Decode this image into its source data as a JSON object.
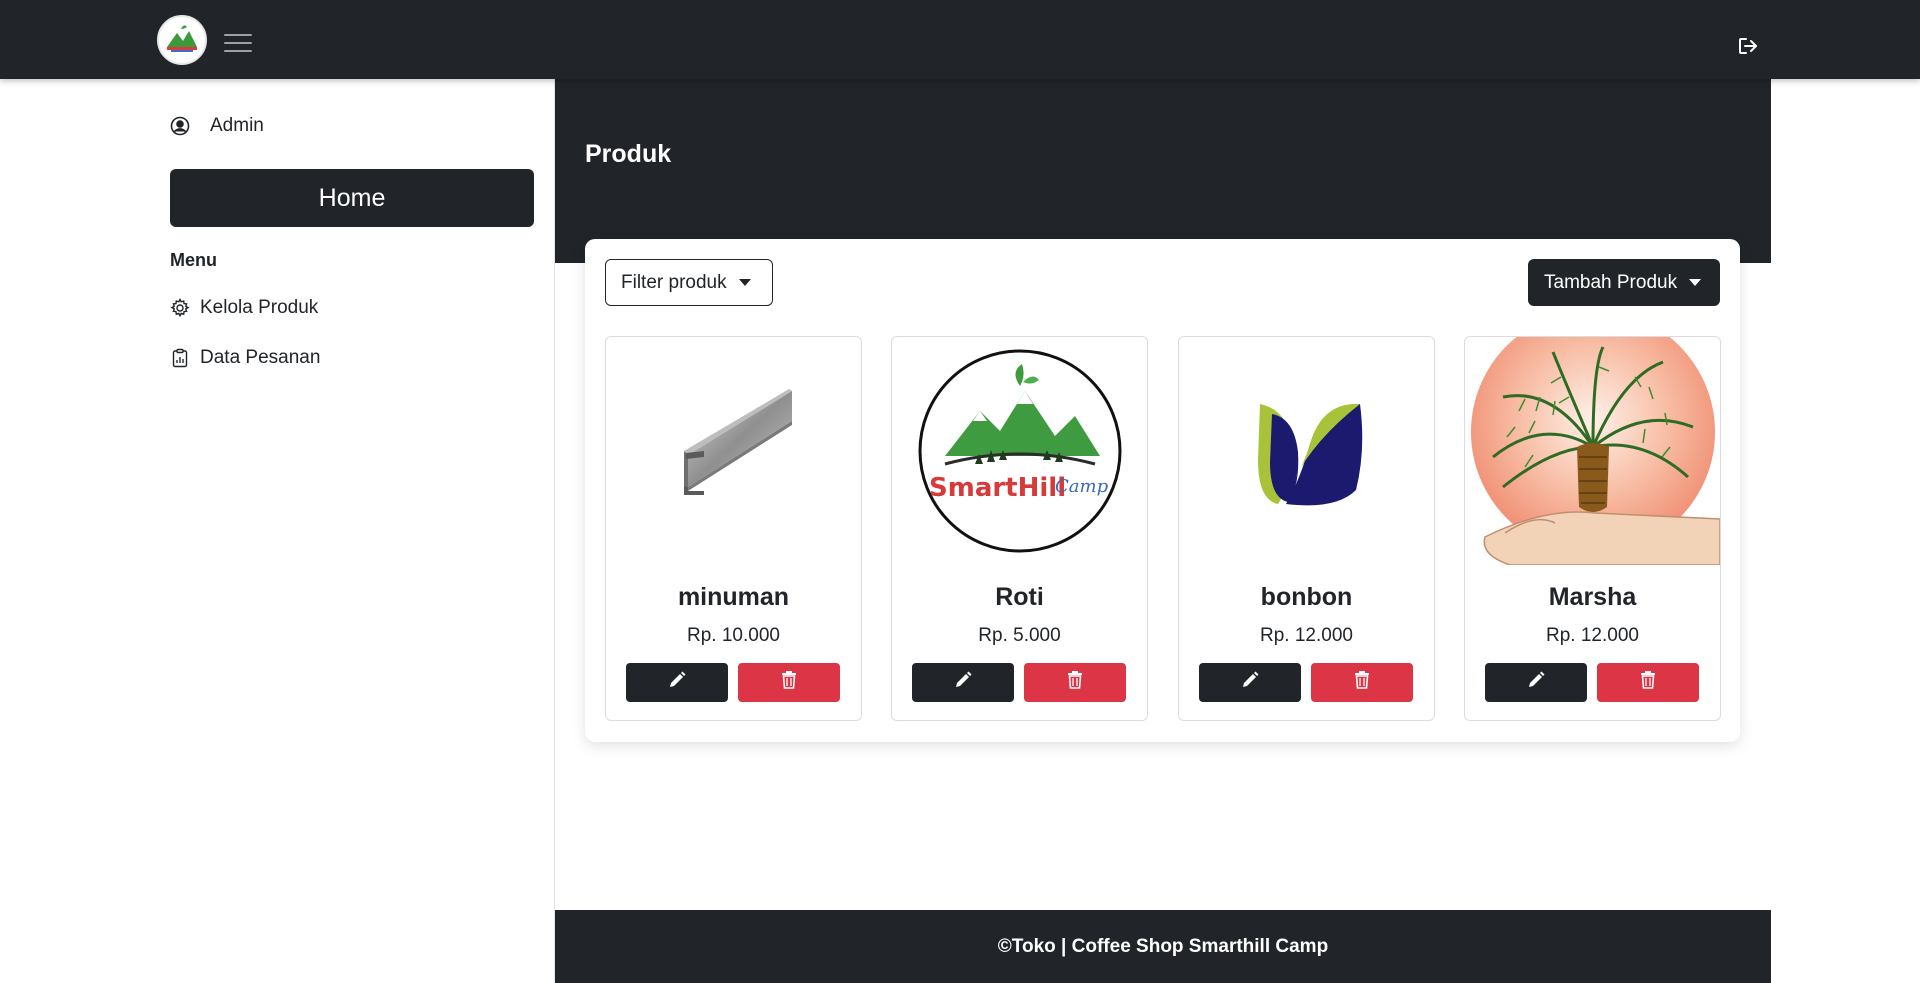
{
  "header": {
    "logo_text": "SmartHill",
    "icons": {
      "menu": "hamburger-icon",
      "logout": "logout-icon"
    }
  },
  "sidebar": {
    "user": {
      "name": "Admin",
      "icon": "user-circle-icon"
    },
    "home_label": "Home",
    "menu_heading": "Menu",
    "items": [
      {
        "label": "Kelola Produk",
        "icon": "gear-icon"
      },
      {
        "label": "Data Pesanan",
        "icon": "clipboard-chart-icon"
      }
    ]
  },
  "main": {
    "title": "Produk",
    "filter_label": "Filter produk",
    "add_label": "Tambah Produk",
    "products": [
      {
        "name": "minuman",
        "price": "Rp. 10.000",
        "image": "steel-channel-image"
      },
      {
        "name": "Roti",
        "price": "Rp. 5.000",
        "image": "smarthill-camp-logo-image"
      },
      {
        "name": "bonbon",
        "price": "Rp. 12.000",
        "image": "leaf-logo-image"
      },
      {
        "name": "Marsha",
        "price": "Rp. 12.000",
        "image": "palm-tree-image"
      }
    ],
    "product_logo_text": {
      "smart": "SmartHill",
      "camp": "Camp"
    }
  },
  "footer": {
    "text": "©Toko | Coffee Shop Smarthill Camp"
  },
  "colors": {
    "dark": "#212529",
    "danger": "#dc3545",
    "white": "#ffffff"
  }
}
